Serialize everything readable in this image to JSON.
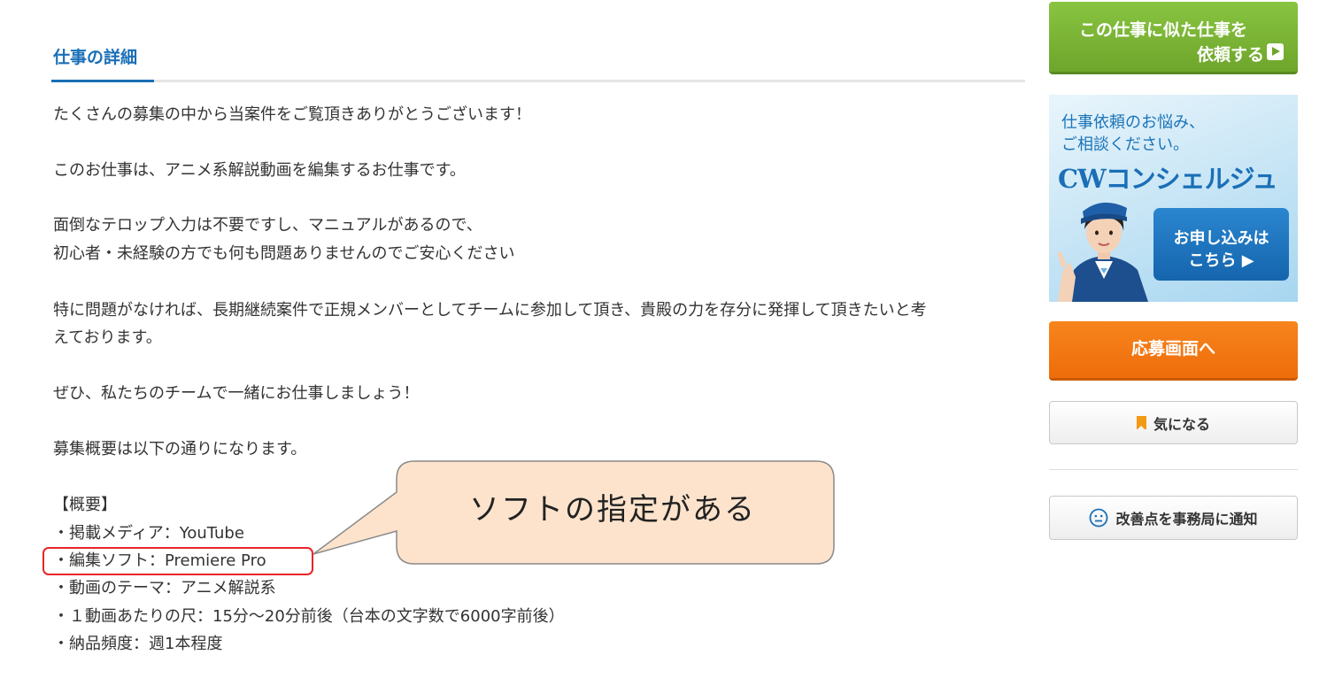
{
  "main": {
    "section_title": "仕事の詳細",
    "lines": [
      "たくさんの募集の中から当案件をご覧頂きありがとうございます！",
      "このお仕事は、アニメ系解説動画を編集するお仕事です。",
      "面倒なテロップ入力は不要ですし、マニュアルがあるので、",
      "初心者・未経験の方でも何も問題ありませんのでご安心ください",
      "特に問題がなければ、長期継続案件で正規メンバーとしてチームに参加して頂き、貴殿の力を存分に発揮して頂きたいと考",
      "えております。",
      "ぜひ、私たちのチームで一緒にお仕事しましょう！",
      "募集概要は以下の通りになります。",
      "【概要】",
      "・掲載メディア：YouTube",
      "・編集ソフト：Premiere Pro",
      "・動画のテーマ：アニメ解説系",
      "・１動画あたりの尺：15分～20分前後（台本の文字数で6000字前後）",
      "・納品頻度：週1本程度"
    ]
  },
  "callout": {
    "text": "ソフトの指定がある"
  },
  "sidebar": {
    "similar_button": {
      "line1": "この仕事に似た仕事を",
      "line2": "依頼する"
    },
    "banner": {
      "text1": "仕事依頼のお悩み、",
      "text2": "ご相談ください。",
      "brand": "CWコンシェルジュ",
      "apply_line1": "お申し込みは",
      "apply_line2": "こちら ▶"
    },
    "apply_button": "応募画面へ",
    "favorite_button": "気になる",
    "report_button": "改善点を事務局に通知"
  },
  "colors": {
    "accent_blue": "#1a6fb7",
    "green_button": "#6ea52b",
    "orange_button": "#ee6d0a",
    "highlight_red": "#e8242a",
    "callout_fill": "#fde3cc"
  }
}
